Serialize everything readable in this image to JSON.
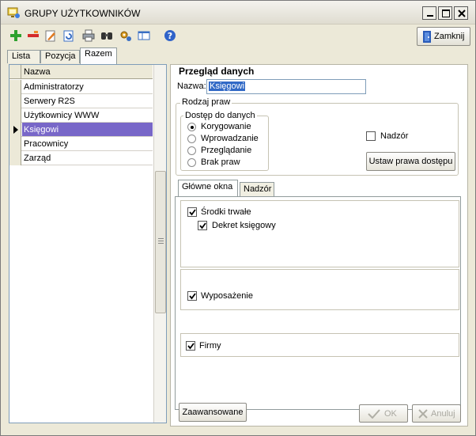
{
  "window": {
    "title": "GRUPY UŻYTKOWNIKÓW"
  },
  "toolbar": {
    "icons": [
      "add-icon",
      "delete-icon",
      "edit-icon",
      "refresh-icon",
      "print-icon",
      "find-icon",
      "settings-icon",
      "columns-icon",
      "help-icon"
    ],
    "close_label": "Zamknij"
  },
  "tabs": [
    {
      "label": "Lista"
    },
    {
      "label": "Pozycja"
    },
    {
      "label": "Razem"
    }
  ],
  "list": {
    "header": "Nazwa",
    "rows": [
      "Administratorzy",
      "Serwery R2S",
      "Użytkownicy WWW",
      "Księgowi",
      "Pracownicy",
      "Zarząd"
    ],
    "selected_index": 3
  },
  "overview": {
    "title": "Przegląd danych",
    "name_label": "Nazwa:",
    "name_value": "Księgowi"
  },
  "rights": {
    "title": "Rodzaj praw",
    "access_title": "Dostęp do danych",
    "options": [
      "Korygowanie",
      "Wprowadzanie",
      "Przeglądanie",
      "Brak praw"
    ],
    "selected": 0,
    "supervision_label": "Nadzór",
    "supervision_checked": false,
    "set_rights_button": "Ustaw prawa dostępu"
  },
  "subtabs": [
    {
      "label": "Główne okna"
    },
    {
      "label": "Nadzór"
    }
  ],
  "modules": {
    "fixed_assets": {
      "label": "Środki trwałe",
      "checked": true
    },
    "decree": {
      "label": "Dekret księgowy",
      "checked": true
    },
    "equipment": {
      "label": "Wyposażenie",
      "checked": true
    },
    "companies": {
      "label": "Firmy",
      "checked": true
    }
  },
  "footer": {
    "advanced": "Zaawansowane",
    "ok": "OK",
    "cancel": "Anuluj"
  },
  "colors": {
    "selection": "#7867c8",
    "input_highlight": "#3169c6",
    "window_bg": "#ece9d8"
  }
}
